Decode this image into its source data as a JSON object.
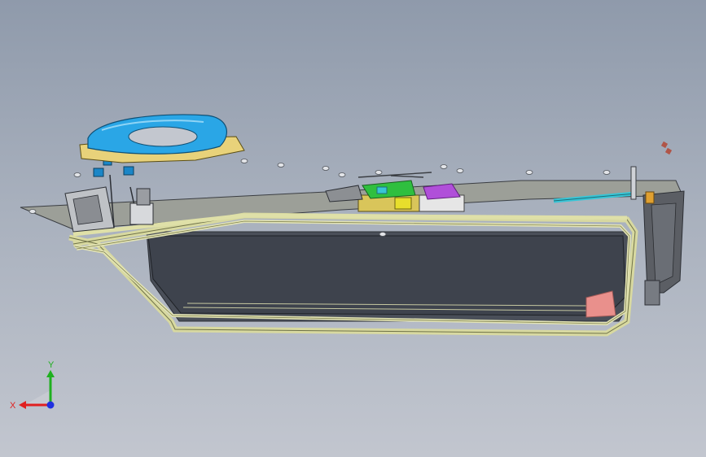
{
  "viewport": {
    "background_top": "#8f9aab",
    "background_bottom": "#c2c6cf"
  },
  "model": {
    "description_icon": "cad-door-assembly",
    "colors": {
      "seal": "#d8d9a0",
      "seal_dark": "#9da06a",
      "glass": "#3e434d",
      "handle": "#2aa6e6",
      "bracket": "#e8d27a",
      "clip_green": "#2fbf3f",
      "clip_purple": "#b04fd9",
      "pink_pad": "#e9908c",
      "cable_cyan": "#38c5d6"
    }
  },
  "triad": {
    "x_label": "X",
    "y_label": "Y",
    "x_color": "#e02020",
    "y_color": "#1fb01f",
    "z_color": "#2030e0"
  }
}
